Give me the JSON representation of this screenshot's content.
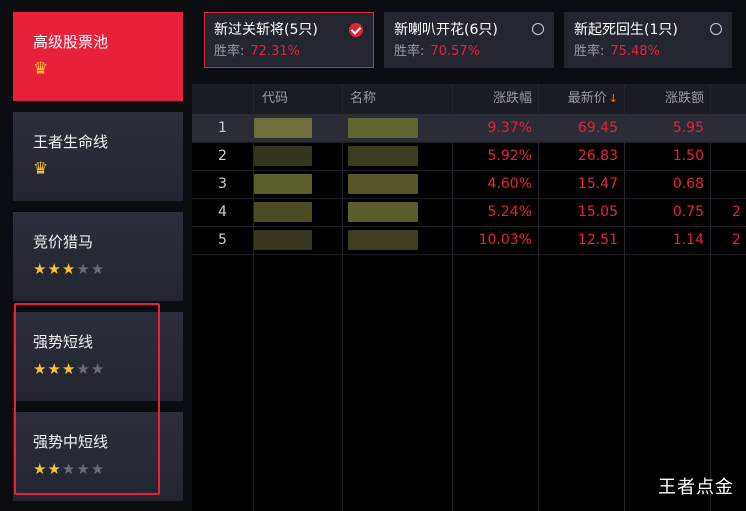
{
  "sidebar": {
    "items": [
      {
        "label": "高级股票池",
        "icon": "crown-icon",
        "active": true
      },
      {
        "label": "王者生命线",
        "icon": "crown-icon",
        "active": false
      },
      {
        "label": "竞价猎马",
        "stars": 3,
        "max_stars": 5
      },
      {
        "label": "强势短线",
        "stars": 3,
        "max_stars": 5
      },
      {
        "label": "强势中短线",
        "stars": 2,
        "max_stars": 5
      }
    ]
  },
  "cards": [
    {
      "title": "新过关斩将(5只)",
      "rate_label": "胜率:",
      "rate_value": "72.31%",
      "selected": true
    },
    {
      "title": "新喇叭开花(6只)",
      "rate_label": "胜率:",
      "rate_value": "70.57%",
      "selected": false
    },
    {
      "title": "新起死回生(1只)",
      "rate_label": "胜率:",
      "rate_value": "75.48%",
      "selected": false
    }
  ],
  "table": {
    "columns": [
      "代码",
      "名称",
      "涨跌幅",
      "最新价",
      "涨跌额"
    ],
    "sort_column": "最新价",
    "sort_direction": "descending",
    "rows": [
      {
        "index": "1",
        "change_pct": "9.37%",
        "price": "69.45",
        "change": "5.95"
      },
      {
        "index": "2",
        "change_pct": "5.92%",
        "price": "26.83",
        "change": "1.50"
      },
      {
        "index": "3",
        "change_pct": "4.60%",
        "price": "15.47",
        "change": "0.68"
      },
      {
        "index": "4",
        "change_pct": "5.24%",
        "price": "15.05",
        "change": "0.75",
        "extra": "2"
      },
      {
        "index": "5",
        "change_pct": "10.03%",
        "price": "12.51",
        "change": "1.14",
        "extra": "2"
      }
    ]
  },
  "watermark": "王者点金",
  "colors": {
    "accent": "#e8213b",
    "gold": "#f6c437",
    "up": "#e8213b"
  }
}
